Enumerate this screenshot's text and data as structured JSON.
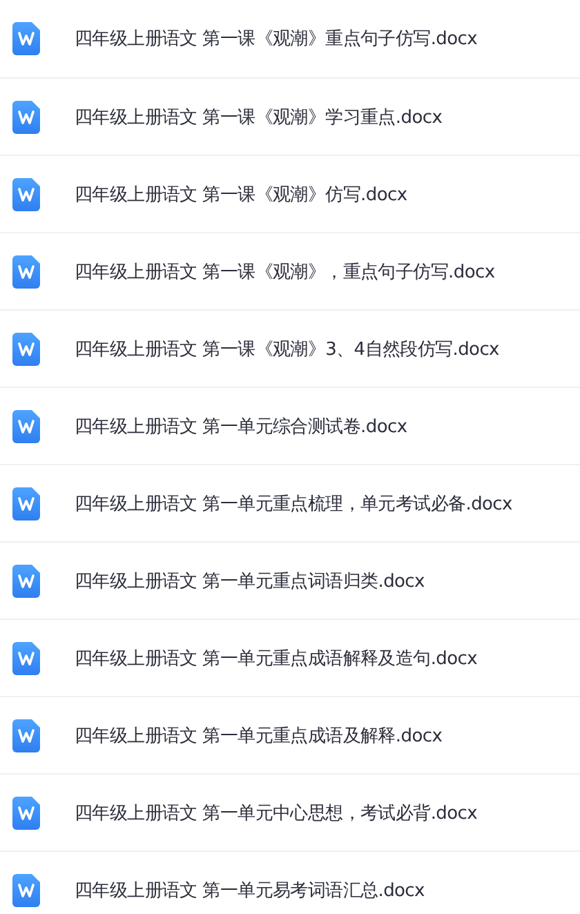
{
  "files": [
    {
      "name": "四年级上册语文 第一课《观潮》重点句子仿写.docx"
    },
    {
      "name": "四年级上册语文 第一课《观潮》学习重点.docx"
    },
    {
      "name": "四年级上册语文 第一课《观潮》仿写.docx"
    },
    {
      "name": "四年级上册语文 第一课《观潮》，重点句子仿写.docx"
    },
    {
      "name": "四年级上册语文 第一课《观潮》3、4自然段仿写.docx"
    },
    {
      "name": "四年级上册语文 第一单元综合测试卷.docx"
    },
    {
      "name": "四年级上册语文 第一单元重点梳理，单元考试必备.docx"
    },
    {
      "name": "四年级上册语文 第一单元重点词语归类.docx"
    },
    {
      "name": "四年级上册语文 第一单元重点成语解释及造句.docx"
    },
    {
      "name": "四年级上册语文 第一单元重点成语及解释.docx"
    },
    {
      "name": "四年级上册语文 第一单元中心思想，考试必背.docx"
    },
    {
      "name": "四年级上册语文 第一单元易考词语汇总.docx"
    }
  ]
}
